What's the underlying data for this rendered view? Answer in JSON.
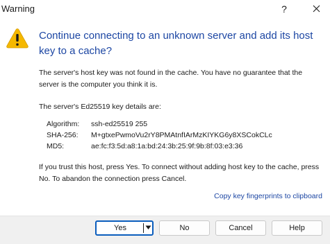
{
  "window": {
    "title": "Warning",
    "help_glyph": "?"
  },
  "dialog": {
    "icon": "warning-icon",
    "heading": "Continue connecting to an unknown server and add its host key to a cache?",
    "paragraph1": "The server's host key was not found in the cache. You have no guarantee that the server is the computer you think it is.",
    "paragraph2": "The server's Ed25519 key details are:",
    "key_details": [
      {
        "label": "Algorithm:",
        "value": "ssh-ed25519 255"
      },
      {
        "label": "SHA-256:",
        "value": "M+gtxePwmoVu2rY8PMAtnfIArMzKIYKG6y8XSCokCLc"
      },
      {
        "label": "MD5:",
        "value": "ae:fc:f3:5d:a8:1a:bd:24:3b:25:9f:9b:8f:03:e3:36"
      }
    ],
    "paragraph3": "If you trust this host, press Yes. To connect without adding host key to the cache, press No. To abandon the connection press Cancel.",
    "copy_link": "Copy key fingerprints to clipboard"
  },
  "buttons": {
    "yes": "Yes",
    "no": "No",
    "cancel": "Cancel",
    "help": "Help"
  },
  "colors": {
    "accent": "#1c46a3",
    "default_button_border": "#0a5dbd",
    "warning_fill": "#f5b800"
  }
}
